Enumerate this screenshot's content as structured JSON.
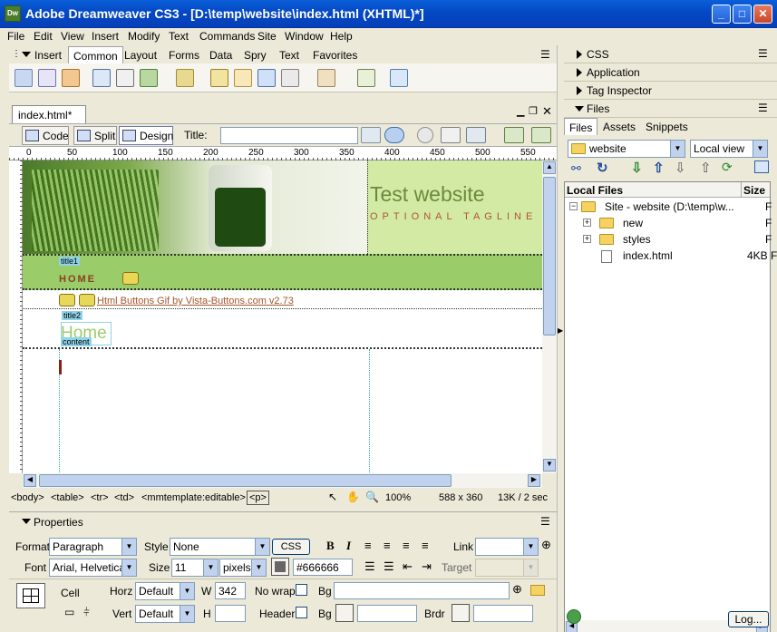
{
  "window": {
    "title": "Adobe Dreamweaver CS3 - [D:\\temp\\website\\index.html (XHTML)*]",
    "app_icon": "Dw"
  },
  "menu": [
    "File",
    "Edit",
    "View",
    "Insert",
    "Modify",
    "Text",
    "Commands",
    "Site",
    "Window",
    "Help"
  ],
  "insert": {
    "label": "Insert",
    "tabs": [
      "Common",
      "Layout",
      "Forms",
      "Data",
      "Spry",
      "Text",
      "Favorites"
    ],
    "active_tab": "Common"
  },
  "document": {
    "tab": "index.html*",
    "views": {
      "code": "Code",
      "split": "Split",
      "design": "Design"
    },
    "title_label": "Title:",
    "title_value": ""
  },
  "ruler": {
    "top": [
      "0",
      "50",
      "100",
      "150",
      "200",
      "250",
      "300",
      "350",
      "400",
      "450",
      "500",
      "550"
    ]
  },
  "page": {
    "site_title": "Test website",
    "tagline": "OPTIONAL TAGLINE",
    "title1_tag": "title1",
    "nav_home": "HOME",
    "link_text": "Html Buttons Gif by Vista-Buttons.com v2.73",
    "title2_tag": "title2",
    "heading": "Home",
    "content_tag": "content"
  },
  "tagbar": {
    "tags": [
      "<body>",
      "<table>",
      "<tr>",
      "<td>",
      "<mmtemplate:editable>",
      "<p>"
    ],
    "zoom": "100%",
    "size": "588 x 360",
    "download": "13K / 2 sec"
  },
  "properties": {
    "title": "Properties",
    "format_label": "Format",
    "format_value": "Paragraph",
    "style_label": "Style",
    "style_value": "None",
    "css_button": "CSS",
    "link_label": "Link",
    "link_value": "",
    "font_label": "Font",
    "font_value": "Arial, Helvetica",
    "size_label": "Size",
    "size_value": "11",
    "unit_value": "pixels",
    "color_value": "#666666",
    "target_label": "Target",
    "cell_label": "Cell",
    "horz_label": "Horz",
    "horz_value": "Default",
    "w_label": "W",
    "w_value": "342",
    "nowrap_label": "No wrap",
    "bg_label": "Bg",
    "vert_label": "Vert",
    "vert_value": "Default",
    "h_label": "H",
    "header_label": "Header",
    "bg2_label": "Bg",
    "brdr_label": "Brdr"
  },
  "panels": {
    "css": "CSS",
    "application": "Application",
    "tag_inspector": "Tag Inspector",
    "files": "Files"
  },
  "files": {
    "tabs": [
      "Files",
      "Assets",
      "Snippets"
    ],
    "site_select": "website",
    "view_select": "Local view",
    "col_name": "Local Files",
    "col_size": "Size",
    "tree": [
      {
        "name": "Site - website (D:\\temp\\w...",
        "size": "F"
      },
      {
        "name": "new",
        "size": "F"
      },
      {
        "name": "styles",
        "size": "F"
      },
      {
        "name": "index.html",
        "size": "4KB F"
      }
    ],
    "log_button": "Log..."
  },
  "colors": {
    "titlebar": "#0548c4",
    "chrome": "#ece9d8",
    "banner_green": "#d3eaa5",
    "nav_green": "#9acc6a",
    "title_text": "#6b8a3a",
    "tagline": "#b0543a"
  }
}
